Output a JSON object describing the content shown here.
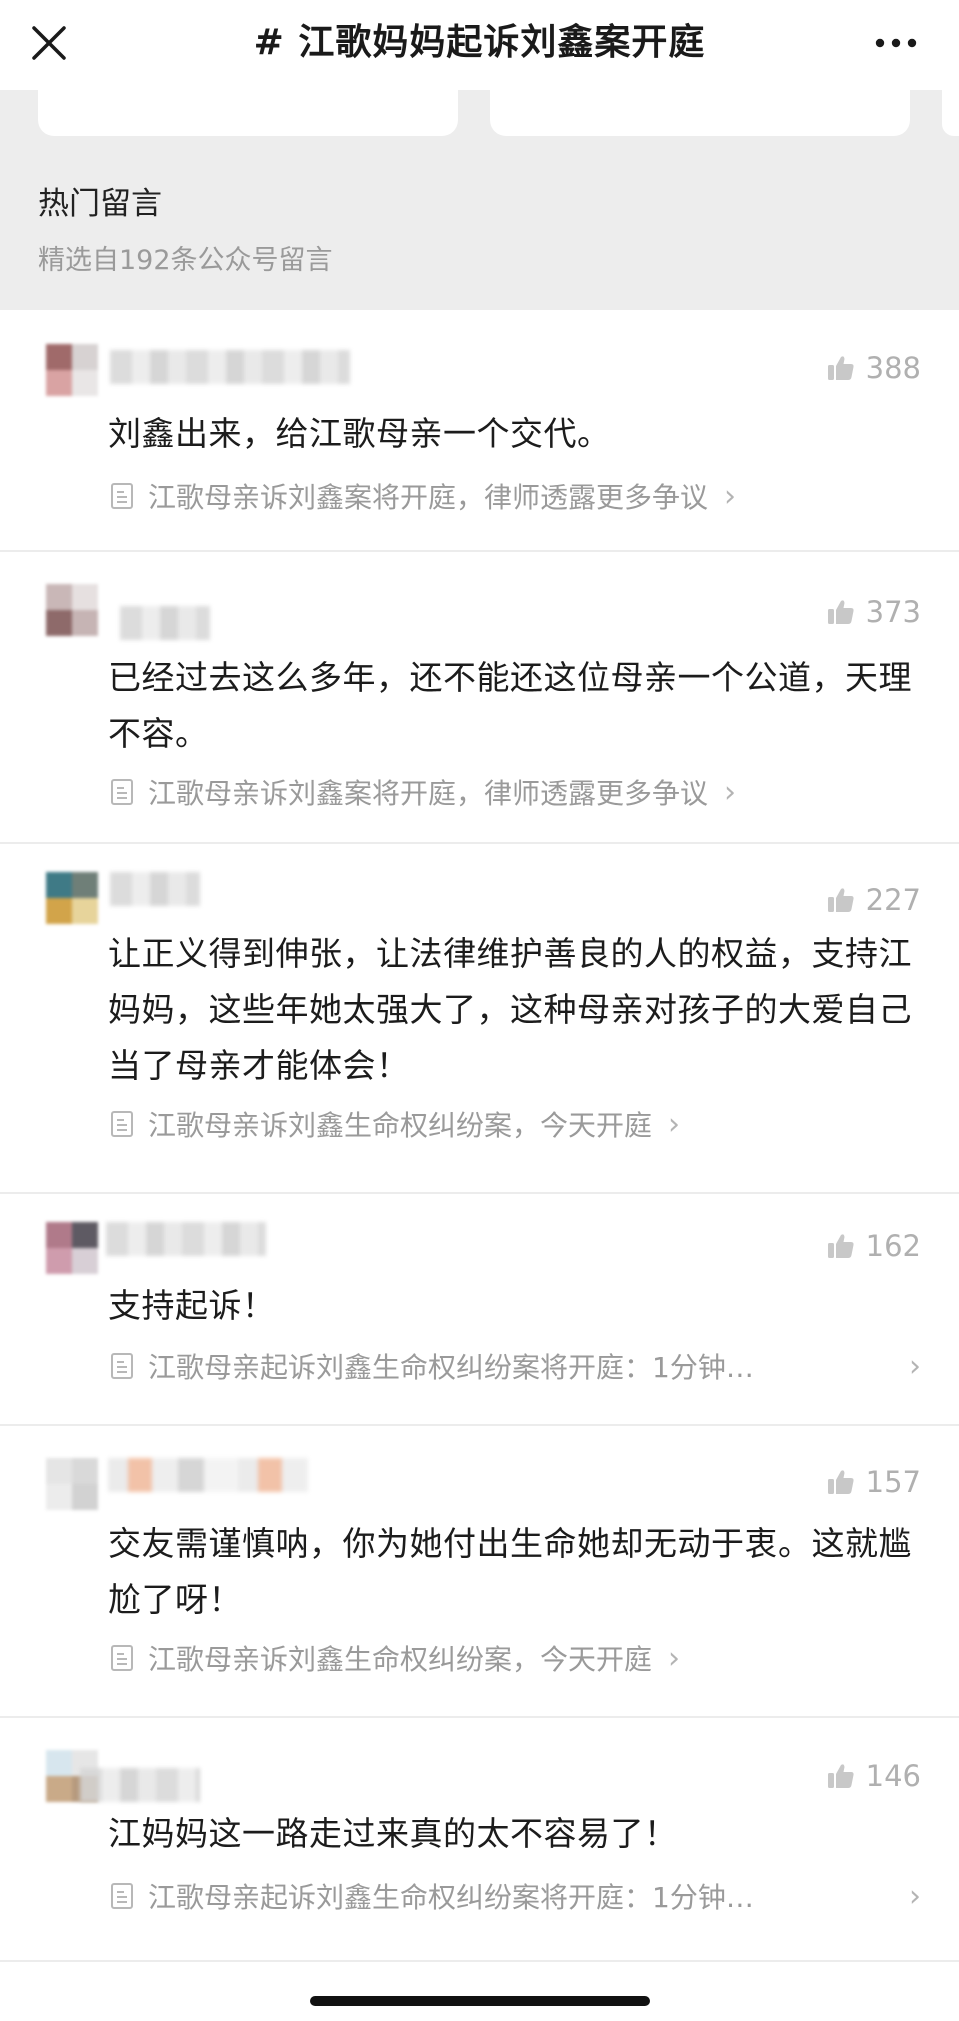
{
  "nav": {
    "title": "# 江歌妈妈起诉刘鑫案开庭",
    "close_icon": "close-icon",
    "more_icon": "more-icon"
  },
  "section": {
    "title": "热门留言",
    "subtitle": "精选自192条公众号留言"
  },
  "comments": [
    {
      "likes": "388",
      "content": "刘鑫出来，给江歌母亲一个交代。",
      "article": "江歌母亲诉刘鑫案将开庭，律师透露更多争议",
      "avatar_colors": [
        "#a06a6a",
        "#d7d2d2",
        "#d9a3a3",
        "#e9e6e6"
      ]
    },
    {
      "likes": "373",
      "content": "已经过去这么多年，还不能还这位母亲一个公道，天理不容。",
      "article": "江歌母亲诉刘鑫案将开庭，律师透露更多争议",
      "avatar_colors": [
        "#c9b7b7",
        "#e6e0e0",
        "#8e6a6a",
        "#c6b4b4"
      ]
    },
    {
      "likes": "227",
      "content": "让正义得到伸张，让法律维护善良的人的权益，支持江妈妈，这些年她太强大了，这种母亲对孩子的大爱自己当了母亲才能体会！",
      "article": "江歌母亲诉刘鑫生命权纠纷案，今天开庭",
      "avatar_colors": [
        "#3f7a86",
        "#6f7f78",
        "#d2a44a",
        "#e7d49b"
      ]
    },
    {
      "likes": "162",
      "content": "支持起诉！",
      "article": "江歌母亲起诉刘鑫生命权纠纷案将开庭：1分钟…",
      "avatar_colors": [
        "#b07a8a",
        "#5e5a63",
        "#cf9cad",
        "#d8cfd6"
      ]
    },
    {
      "likes": "157",
      "content": "交友需谨慎呐，你为她付出生命她却无动于衷。这就尴尬了呀！",
      "article": "江歌母亲诉刘鑫生命权纠纷案，今天开庭",
      "avatar_colors": [
        "#e5e5e5",
        "#d9d9d9",
        "#ececec",
        "#d2d2d2"
      ]
    },
    {
      "likes": "146",
      "content": "江妈妈这一路走过来真的太不容易了！",
      "article": "江歌母亲起诉刘鑫生命权纠纷案将开庭：1分钟…",
      "avatar_colors": [
        "#d7e6ee",
        "#e6e6e6",
        "#c9aa88",
        "#b69a7e"
      ]
    }
  ],
  "colors": {
    "section_bg": "#ededed",
    "muted_text": "#9a9a9a",
    "like_gray": "#b0b0b0"
  }
}
